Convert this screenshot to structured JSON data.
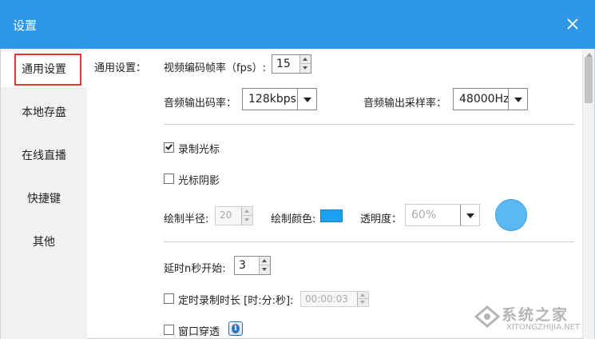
{
  "window": {
    "title": "设置"
  },
  "sidebar": {
    "items": [
      {
        "label": "通用设置",
        "active": true
      },
      {
        "label": "本地存盘"
      },
      {
        "label": "在线直播"
      },
      {
        "label": "快捷键"
      },
      {
        "label": "其他"
      }
    ]
  },
  "general": {
    "section_label": "通用设置：",
    "fps_label": "视频编码帧率（fps）:",
    "fps_value": "15",
    "bitrate_label": "音频输出码率：",
    "bitrate_value": "128kbps",
    "samplerate_label": "音频输出采样率：",
    "samplerate_value": "48000Hz"
  },
  "cursor": {
    "record_cursor_label": "录制光标",
    "record_cursor_checked": true,
    "cursor_shadow_label": "光标阴影",
    "cursor_shadow_checked": false,
    "radius_label": "绘制半径:",
    "radius_value": "20",
    "color_label": "绘制颜色:",
    "color_hex": "#1ea0f0",
    "opacity_label": "透明度：",
    "opacity_value": "60%",
    "preview_color": "#5ab8f5"
  },
  "timing": {
    "delay_label": "延时n秒开始:",
    "delay_value": "3",
    "timed_label": "定时录制时长 [时:分:秒]:",
    "timed_checked": false,
    "timed_value": "00:00:03",
    "window_through_label": "窗口穿透",
    "window_through_checked": false
  },
  "watermark": {
    "text": "系统之家",
    "sub": "XITONGZHIJIA.NET"
  },
  "colors": {
    "titlebar": "#2f97e8",
    "highlight_border": "#e53935"
  }
}
